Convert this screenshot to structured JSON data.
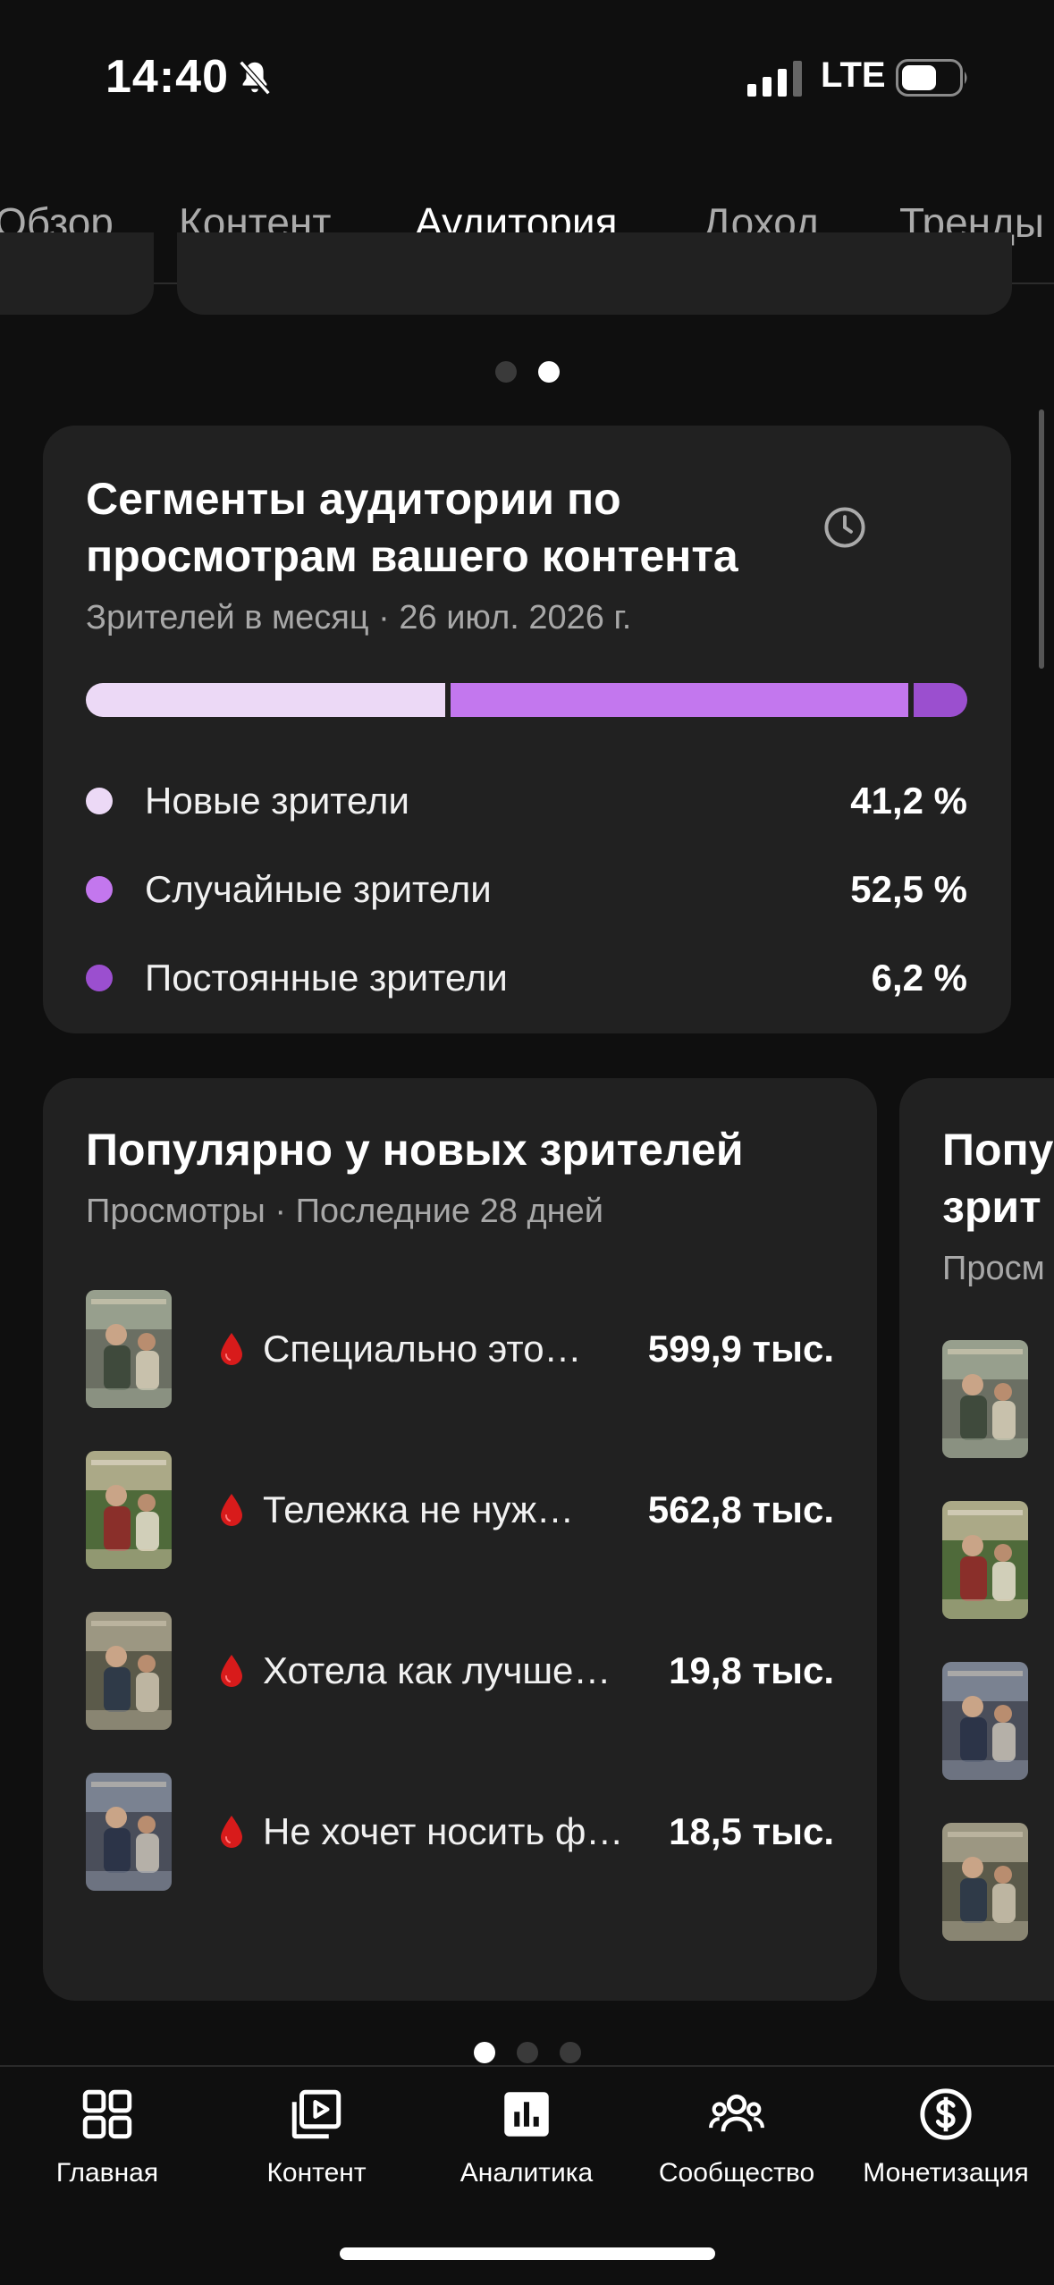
{
  "status_bar": {
    "time": "14:40",
    "network": "LTE",
    "icons": [
      "bell-slash-icon",
      "cellular-signal-icon",
      "battery-icon"
    ]
  },
  "tabs": [
    {
      "label": "Обзор",
      "active": false
    },
    {
      "label": "Контент",
      "active": false
    },
    {
      "label": "Аудитория",
      "active": true
    },
    {
      "label": "Доход",
      "active": false
    },
    {
      "label": "Тренды",
      "active": false
    }
  ],
  "top_carousel": {
    "pages": 2,
    "current": 2
  },
  "segments_card": {
    "title_line1": "Сегменты аудитории по",
    "title_line2": "просмотрам вашего контента",
    "subtitle": "Зрителей в месяц · 26 июл. 2026 г.",
    "icon": "history-icon",
    "segments": [
      {
        "label": "Новые зрители",
        "value": "41,2 %",
        "share": 41.2,
        "color": "#ecd9f6"
      },
      {
        "label": "Случайные зрители",
        "value": "52,5 %",
        "share": 52.5,
        "color": "#c377ee"
      },
      {
        "label": "Постоянные зрители",
        "value": "6,2 %",
        "share": 6.2,
        "color": "#9b4fcf"
      }
    ]
  },
  "popular_card": {
    "title": "Популярно у новых зрителей",
    "subtitle": "Просмотры · Последние 28 дней",
    "videos": [
      {
        "title": "Специально это…",
        "views": "599,9 тыс."
      },
      {
        "title": "Тележка не нуж…",
        "views": "562,8 тыс."
      },
      {
        "title": "Хотела как лучше…",
        "views": "19,8 тыс."
      },
      {
        "title": "Не хочет носить ф…",
        "views": "18,5 тыс."
      }
    ]
  },
  "popular_card_next": {
    "title_line1": "Попу",
    "title_line2": "зрит",
    "subtitle": "Просм"
  },
  "bottom_carousel": {
    "pages": 3,
    "current": 1
  },
  "bottom_nav": [
    {
      "label": "Главная",
      "icon": "dashboard-grid-icon",
      "active": false
    },
    {
      "label": "Контент",
      "icon": "video-library-icon",
      "active": false
    },
    {
      "label": "Аналитика",
      "icon": "analytics-bar-icon",
      "active": true
    },
    {
      "label": "Сообщество",
      "icon": "community-people-icon",
      "active": false
    },
    {
      "label": "Монетизация",
      "icon": "dollar-circle-icon",
      "active": false
    }
  ]
}
